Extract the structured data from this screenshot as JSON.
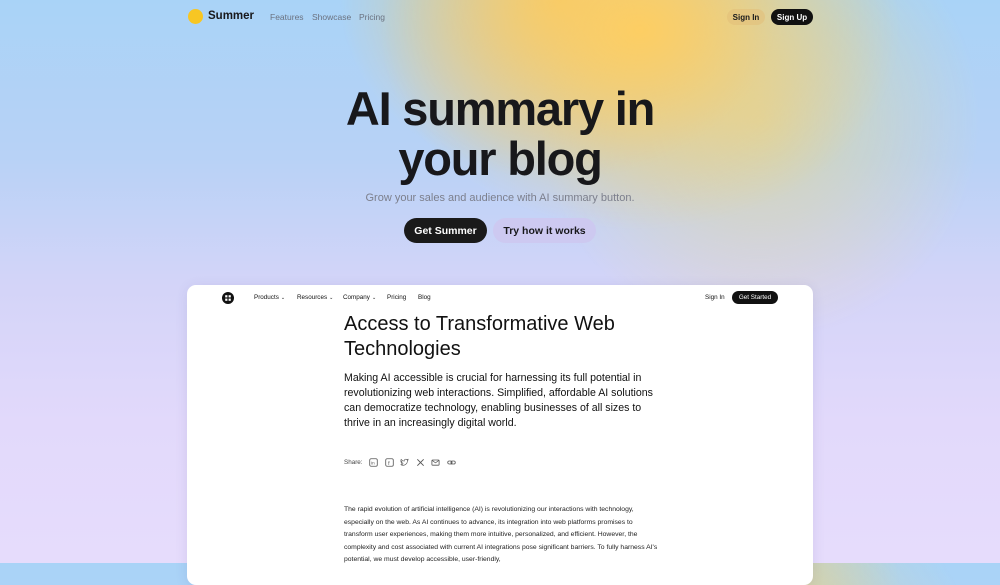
{
  "topnav": {
    "brand": "Summer",
    "links": [
      "Features",
      "Showcase",
      "Pricing"
    ],
    "signin_label": "Sign In",
    "signup_label": "Sign Up"
  },
  "hero": {
    "title_line1": "AI summary in",
    "title_line2": "your blog",
    "subtitle": "Grow your sales and audience with AI summary button.",
    "primary_cta": "Get Summer",
    "secondary_cta": "Try how it works"
  },
  "preview": {
    "nav": {
      "items": [
        {
          "label": "Products",
          "has_dropdown": true
        },
        {
          "label": "Resources",
          "has_dropdown": true
        },
        {
          "label": "Company",
          "has_dropdown": true
        },
        {
          "label": "Pricing",
          "has_dropdown": false
        },
        {
          "label": "Blog",
          "has_dropdown": false
        }
      ],
      "signin_label": "Sign In",
      "cta_label": "Get Started"
    },
    "article": {
      "title": "Access to Transformative Web Technologies",
      "lead": "Making AI accessible is crucial for harnessing its full potential in revolutionizing web interactions. Simplified, affordable AI solutions can democratize technology, enabling businesses of all sizes to thrive in an increasingly digital world.",
      "share_label": "Share:",
      "share_icons": [
        "linkedin-icon",
        "facebook-icon",
        "twitter-icon",
        "x-icon",
        "email-icon",
        "link-icon"
      ],
      "body": "The rapid evolution of artificial intelligence (AI) is revolutionizing our interactions with technology, especially on the web. As AI continues to advance, its integration into web platforms promises to transform user experiences, making them more intuitive, personalized, and efficient. However, the complexity and cost associated with current AI integrations pose significant barriers. To fully harness AI's potential, we must develop accessible, user-friendly,"
    }
  },
  "colors": {
    "accent_yellow": "#f7c623",
    "dark_button": "#111111",
    "secondary_button": "#cdc8f0"
  }
}
